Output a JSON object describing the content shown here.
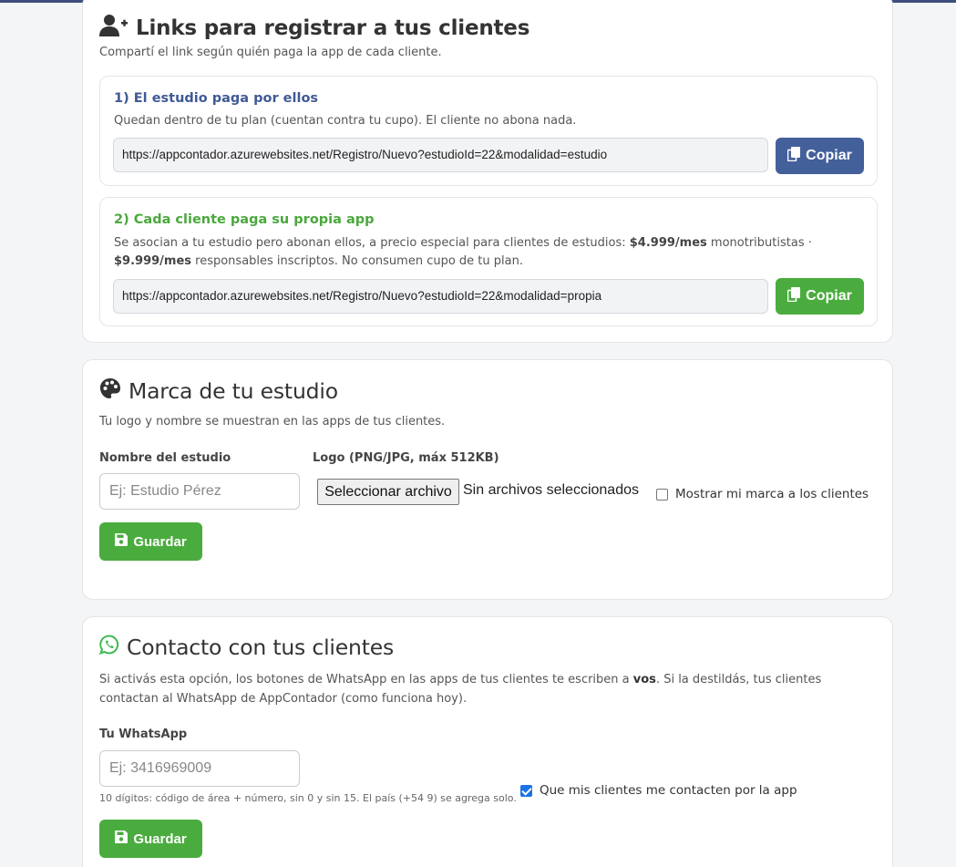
{
  "links_card": {
    "title": "Links para registrar a tus clientes",
    "subtitle": "Compartí el link según quién paga la app de cada cliente.",
    "icon": "user-plus-icon",
    "option1": {
      "title": "1) El estudio paga por ellos",
      "text": "Quedan dentro de tu plan (cuentan contra tu cupo). El cliente no abona nada.",
      "url": "https://appcontador.azurewebsites.net/Registro/Nuevo?estudioId=22&modalidad=estudio",
      "copy_label": "Copiar",
      "color": "#44609b"
    },
    "option2": {
      "title": "2) Cada cliente paga su propia app",
      "text_before": "Se asocian a tu estudio pero abonan ellos, a precio especial para clientes de estudios: ",
      "price1": "$4.999/mes",
      "text_mid": " monotributistas · ",
      "price2": "$9.999/mes",
      "text_after": " responsables inscriptos. No consumen cupo de tu plan.",
      "url": "https://appcontador.azurewebsites.net/Registro/Nuevo?estudioId=22&modalidad=propia",
      "copy_label": "Copiar",
      "color": "#4aac3e"
    }
  },
  "brand_card": {
    "title": "Marca de tu estudio",
    "subtitle": "Tu logo y nombre se muestran en las apps de tus clientes.",
    "icon": "palette-icon",
    "name_label": "Nombre del estudio",
    "name_placeholder": "Ej: Estudio Pérez",
    "logo_label": "Logo (PNG/JPG, máx 512KB)",
    "file_button": "Seleccionar archivo",
    "file_status": "Sin archivos seleccionados",
    "show_brand_label": "Mostrar mi marca a los clientes",
    "show_brand_checked": false,
    "save_label": "Guardar"
  },
  "contact_card": {
    "title": "Contacto con tus clientes",
    "icon": "whatsapp-icon",
    "desc_before": "Si activás esta opción, los botones de WhatsApp en las apps de tus clientes te escriben a ",
    "desc_bold": "vos",
    "desc_after": ". Si la destildás, tus clientes contactan al WhatsApp de AppContador (como funciona hoy).",
    "whatsapp_label": "Tu WhatsApp",
    "whatsapp_placeholder": "Ej: 3416969009",
    "hint": "10 dígitos: código de área + número, sin 0 y sin 15. El país (+54 9) se agrega solo.",
    "contact_label": "Que mis clientes me contacten por la app",
    "contact_checked": true,
    "save_label": "Guardar"
  }
}
